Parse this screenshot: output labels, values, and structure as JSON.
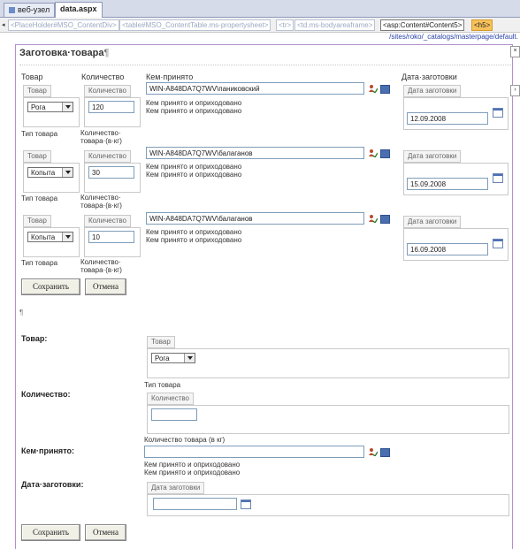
{
  "tabs": [
    {
      "label": "веб-узел"
    },
    {
      "label": "data.aspx"
    }
  ],
  "breadcrumbs": [
    "<PlaceHolder#MSO_ContentDiv>",
    "<table#MSO_ContentTable.ms-propertysheet>",
    "<tr>",
    "<td.ms-bodyareaframe>",
    "<asp:Content#Content5>",
    "<h5>"
  ],
  "path": "/sites/roko/_catalogs/masterpage/default.",
  "page_title": "Заготовка·товара",
  "pilcrow": "¶",
  "columns": {
    "product": "Товар",
    "quantity": "Количество",
    "received_by": "Кем·принято",
    "date": "Дата·заготовки"
  },
  "labels": {
    "product_pill": "Товар",
    "quantity_pill": "Количество",
    "date_pill": "Дата заготовки",
    "product_type": "Тип товара",
    "quantity_kg_1": "Количество·",
    "quantity_kg_2": "товара·(в·кг)",
    "accepted_1": "Кем принято и оприходовано",
    "accepted_2": "Кем принято и оприходовано"
  },
  "rows": [
    {
      "product": "Рога",
      "quantity": "120",
      "person": "WIN-A848DA7Q7WV\\паниковский",
      "date": "12.09.2008"
    },
    {
      "product": "Копыта",
      "quantity": "30",
      "person": "WIN-A848DA7Q7WV\\балаганов",
      "date": "15.09.2008"
    },
    {
      "product": "Копыта",
      "quantity": "10",
      "person": "WIN-A848DA7Q7WV\\балаганов",
      "date": "16.09.2008"
    }
  ],
  "buttons": {
    "save": "Сохранить",
    "cancel": "Отмена"
  },
  "form": {
    "product_label": "Товар:",
    "quantity_label": "Количество:",
    "received_label": "Кем·принято:",
    "date_label": "Дата·заготовки:",
    "product_value": "Рога",
    "product_type": "Тип товара",
    "quantity_value": "",
    "quantity_hint": "Количество товара (в кг)",
    "person_value": "",
    "accepted_1": "Кем принято и оприходовано",
    "accepted_2": "Кем принято и оприходовано",
    "date_value": ""
  },
  "colors": {
    "frame": "#b28fcf",
    "highlight_tag": "#f7c25b"
  }
}
